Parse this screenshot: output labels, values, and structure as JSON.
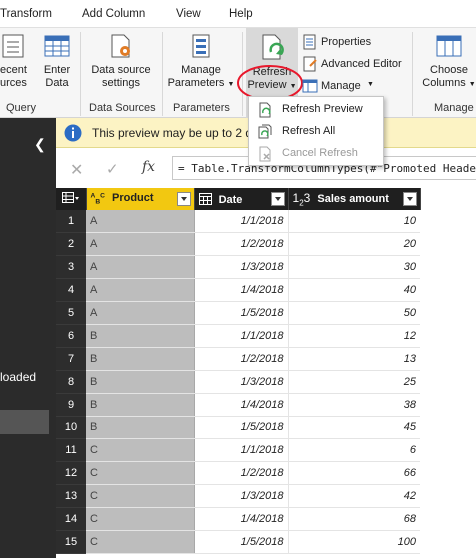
{
  "menu": [
    "Transform",
    "Add Column",
    "View",
    "Help"
  ],
  "ribbon": {
    "recent_sources": [
      "ecent",
      "urces"
    ],
    "enter_data": [
      "Enter",
      "Data"
    ],
    "data_source_settings": [
      "Data source",
      "settings"
    ],
    "manage_parameters": [
      "Manage",
      "Parameters"
    ],
    "refresh_preview": [
      "Refresh",
      "Preview"
    ],
    "properties": "Properties",
    "advanced_editor": "Advanced Editor",
    "manage": "Manage",
    "choose_columns": [
      "Choose",
      "Columns"
    ],
    "groups": {
      "query": "Query",
      "data_sources": "Data Sources",
      "parameters": "Parameters",
      "manage": "Manage"
    }
  },
  "dropdown": {
    "items": [
      "Refresh Preview",
      "Refresh All",
      "Cancel Refresh"
    ],
    "disabled": [
      false,
      false,
      true
    ]
  },
  "infobar": {
    "text": "This preview may be up to 2 d"
  },
  "formula": {
    "text": "= Table.TransformColumnTypes(#\"Promoted Heade"
  },
  "left_panel": {
    "label": "loaded"
  },
  "grid": {
    "columns": [
      {
        "type_icon": "ABC",
        "name": "Product"
      },
      {
        "type_icon": "calendar",
        "name": "Date"
      },
      {
        "type_icon": "123",
        "name": "Sales amount"
      }
    ],
    "rows": [
      {
        "n": "1",
        "product": "A",
        "date": "1/1/2018",
        "sales": "10"
      },
      {
        "n": "2",
        "product": "A",
        "date": "1/2/2018",
        "sales": "20"
      },
      {
        "n": "3",
        "product": "A",
        "date": "1/3/2018",
        "sales": "30"
      },
      {
        "n": "4",
        "product": "A",
        "date": "1/4/2018",
        "sales": "40"
      },
      {
        "n": "5",
        "product": "A",
        "date": "1/5/2018",
        "sales": "50"
      },
      {
        "n": "6",
        "product": "B",
        "date": "1/1/2018",
        "sales": "12"
      },
      {
        "n": "7",
        "product": "B",
        "date": "1/2/2018",
        "sales": "13"
      },
      {
        "n": "8",
        "product": "B",
        "date": "1/3/2018",
        "sales": "25"
      },
      {
        "n": "9",
        "product": "B",
        "date": "1/4/2018",
        "sales": "38"
      },
      {
        "n": "10",
        "product": "B",
        "date": "1/5/2018",
        "sales": "45"
      },
      {
        "n": "11",
        "product": "C",
        "date": "1/1/2018",
        "sales": "6"
      },
      {
        "n": "12",
        "product": "C",
        "date": "1/2/2018",
        "sales": "66"
      },
      {
        "n": "13",
        "product": "C",
        "date": "1/3/2018",
        "sales": "42"
      },
      {
        "n": "14",
        "product": "C",
        "date": "1/4/2018",
        "sales": "68"
      },
      {
        "n": "15",
        "product": "C",
        "date": "1/5/2018",
        "sales": "100"
      }
    ]
  },
  "colors": {
    "header_bg": "#1f1f1f",
    "product_header": "#f2c811",
    "info_bg": "#fcf3c4",
    "highlight_circle": "#e8182c"
  }
}
